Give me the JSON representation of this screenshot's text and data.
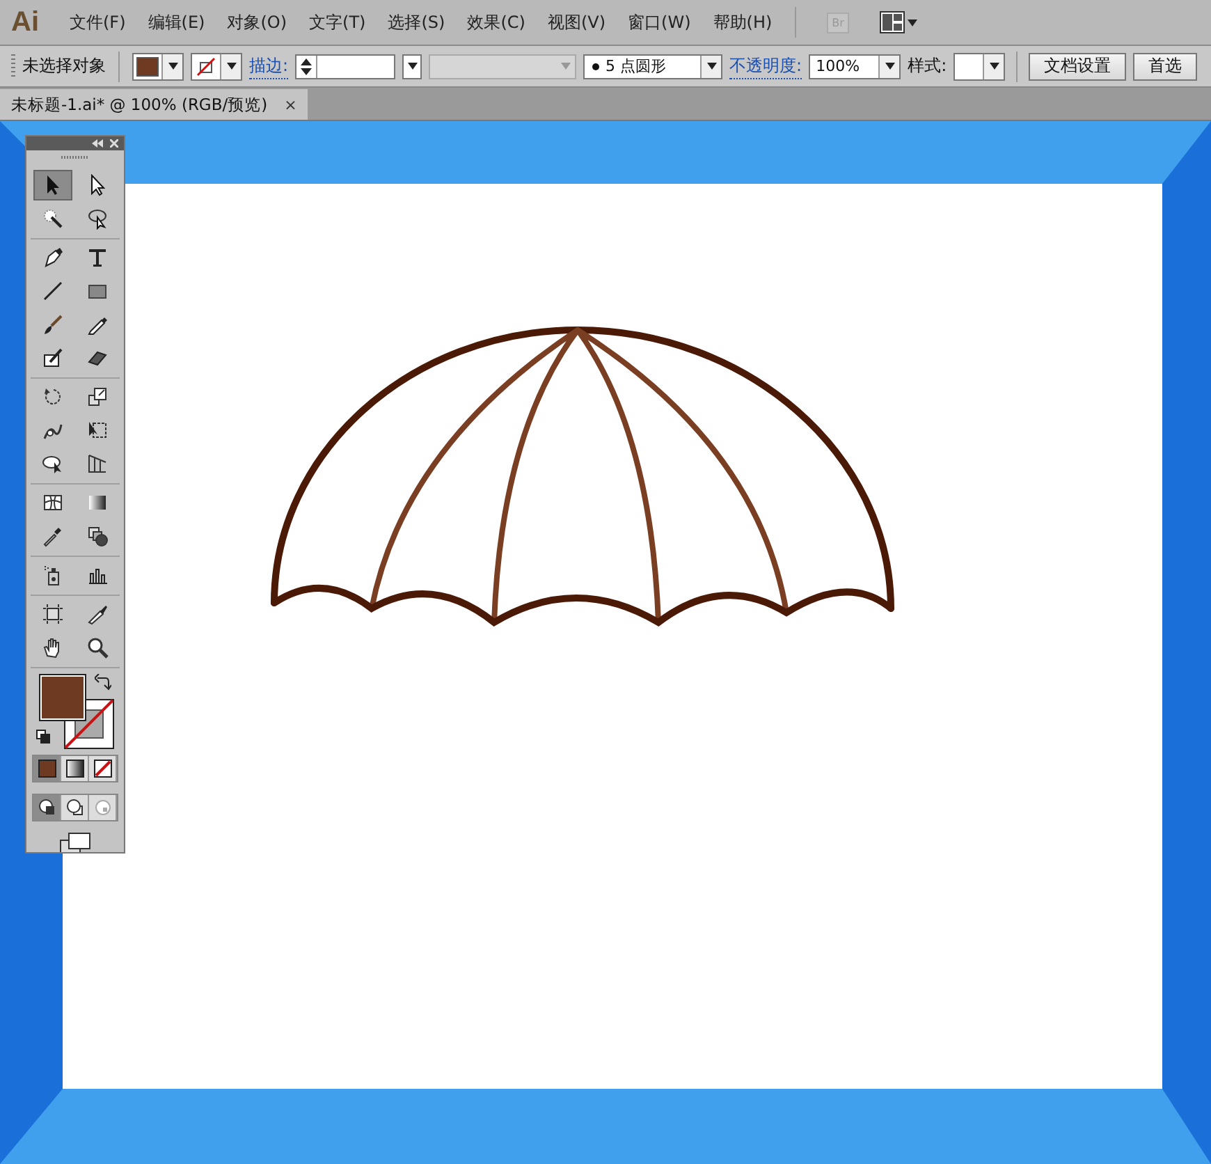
{
  "app": {
    "logo": "Ai"
  },
  "menu": [
    "文件(F)",
    "编辑(E)",
    "对象(O)",
    "文字(T)",
    "选择(S)",
    "效果(C)",
    "视图(V)",
    "窗口(W)",
    "帮助(H)"
  ],
  "bridge_button": "Br",
  "control_bar": {
    "selection": "未选择对象",
    "swatches": [
      {
        "kind": "fill",
        "color": "#6e3b22"
      },
      {
        "kind": "none"
      }
    ],
    "stroke_label": "描边:",
    "brush": "5 点圆形",
    "opacity_label": "不透明度:",
    "opacity": "100%",
    "style_label": "样式:",
    "buttons": [
      "文档设置",
      "首选"
    ]
  },
  "document_tab": {
    "title": "未标题-1.ai* @ 100% (RGB/预览)",
    "close": "×"
  },
  "toolbox": {
    "tool_groups": [
      [
        {
          "kind": "selection",
          "selected": true
        },
        {
          "kind": "direct-selection",
          "selected": false
        },
        {
          "kind": "magic-wand",
          "selected": false
        },
        {
          "kind": "lasso",
          "selected": false
        }
      ],
      [
        {
          "kind": "pen",
          "selected": false
        },
        {
          "kind": "type",
          "selected": false
        },
        {
          "kind": "line",
          "selected": false
        },
        {
          "kind": "rectangle",
          "selected": false
        },
        {
          "kind": "paintbrush",
          "selected": false
        },
        {
          "kind": "pencil",
          "selected": false
        },
        {
          "kind": "blob-brush",
          "selected": false
        },
        {
          "kind": "eraser",
          "selected": false
        }
      ],
      [
        {
          "kind": "rotate",
          "selected": false
        },
        {
          "kind": "scale",
          "selected": false
        },
        {
          "kind": "warp",
          "selected": false
        },
        {
          "kind": "free-transform",
          "selected": false
        },
        {
          "kind": "shape-builder",
          "selected": false
        },
        {
          "kind": "perspective-grid",
          "selected": false
        }
      ],
      [
        {
          "kind": "mesh",
          "selected": false
        },
        {
          "kind": "gradient",
          "selected": false
        },
        {
          "kind": "eyedropper",
          "selected": false
        },
        {
          "kind": "blend",
          "selected": false
        }
      ],
      [
        {
          "kind": "symbol-sprayer",
          "selected": false
        },
        {
          "kind": "column-graph",
          "selected": false
        }
      ],
      [
        {
          "kind": "artboard",
          "selected": false
        },
        {
          "kind": "slice",
          "selected": false
        },
        {
          "kind": "hand",
          "selected": false
        },
        {
          "kind": "zoom",
          "selected": false
        }
      ]
    ],
    "swatches": [
      {
        "kind": "fill",
        "color": "#6e3b22"
      },
      {
        "kind": "none"
      }
    ],
    "color_modes": [
      {
        "kind": "color",
        "selected": true
      },
      {
        "kind": "gradient",
        "selected": false
      },
      {
        "kind": "none",
        "selected": false
      }
    ],
    "draw_modes": [
      {
        "kind": "normal",
        "selected": true
      },
      {
        "kind": "behind",
        "selected": false
      },
      {
        "kind": "inside",
        "selected": false
      }
    ]
  }
}
